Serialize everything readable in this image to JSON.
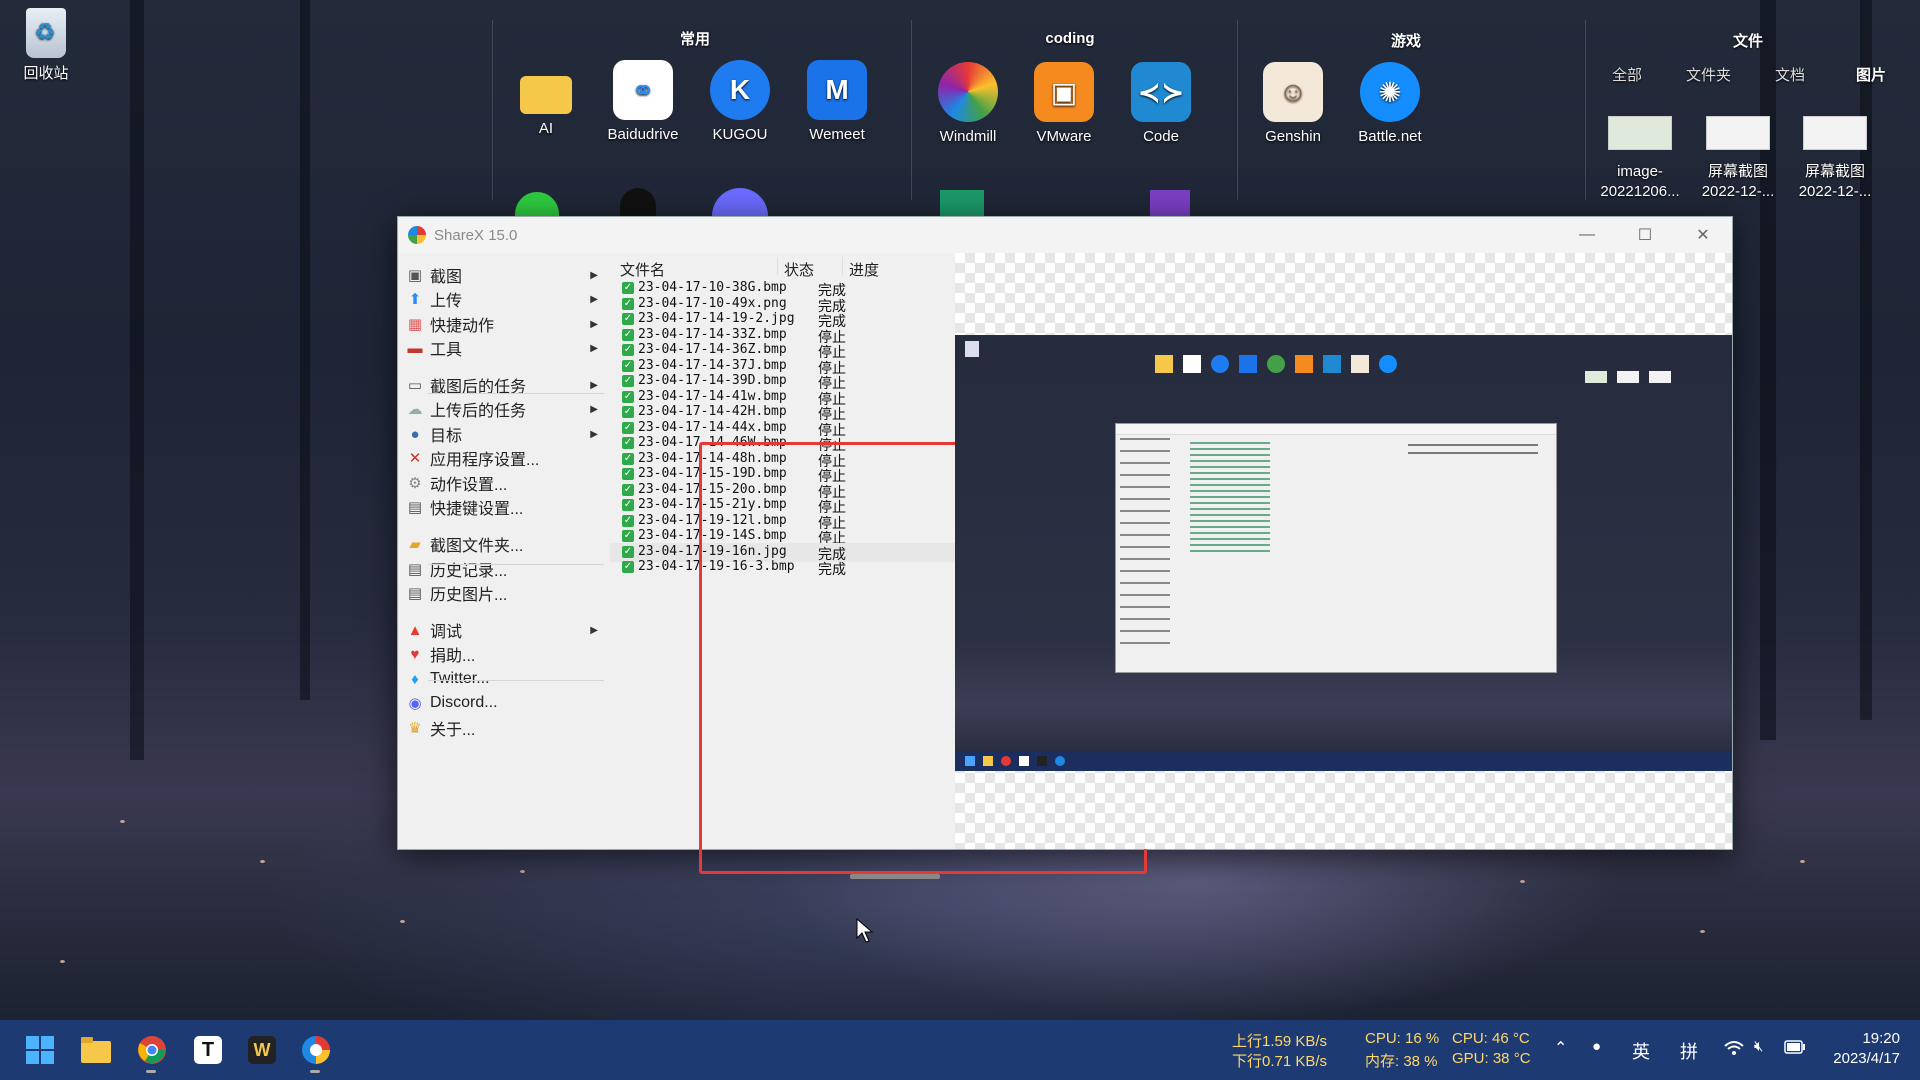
{
  "desktop": {
    "recycle_bin": "回收站",
    "groups": [
      {
        "title": "常用",
        "icons": [
          "AI",
          "Baidudrive",
          "KUGOU",
          "Wemeet"
        ]
      },
      {
        "title": "coding",
        "icons": [
          "Windmill",
          "VMware",
          "Code"
        ]
      },
      {
        "title": "游戏",
        "icons": [
          "Genshin",
          "Battle.net"
        ]
      },
      {
        "title": "文件",
        "tabs": [
          "全部",
          "文件夹",
          "文档",
          "图片"
        ],
        "files": [
          {
            "l1": "image-",
            "l2": "20221206..."
          },
          {
            "l1": "屏幕截图",
            "l2": "2022-12-..."
          },
          {
            "l1": "屏幕截图",
            "l2": "2022-12-..."
          }
        ]
      }
    ]
  },
  "window": {
    "title": "ShareX 15.0",
    "menu": [
      {
        "label": "截图",
        "icon": "camera-icon",
        "submenu": true
      },
      {
        "label": "上传",
        "icon": "upload-arrow-icon",
        "submenu": true
      },
      {
        "label": "快捷动作",
        "icon": "grid-icon",
        "submenu": true
      },
      {
        "label": "工具",
        "icon": "toolbox-icon",
        "submenu": true
      },
      {
        "label": "截图后的任务",
        "icon": "monitor-icon",
        "submenu": true
      },
      {
        "label": "上传后的任务",
        "icon": "cloud-icon",
        "submenu": true
      },
      {
        "label": "目标",
        "icon": "user-icon",
        "submenu": true
      },
      {
        "label": "应用程序设置...",
        "icon": "wrench-icon",
        "submenu": false
      },
      {
        "label": "动作设置...",
        "icon": "gear-icon",
        "submenu": false
      },
      {
        "label": "快捷键设置...",
        "icon": "keyboard-icon",
        "submenu": false
      },
      {
        "label": "截图文件夹...",
        "icon": "folder-icon",
        "submenu": false
      },
      {
        "label": "历史记录...",
        "icon": "history-icon",
        "submenu": false
      },
      {
        "label": "历史图片...",
        "icon": "image-history-icon",
        "submenu": false
      },
      {
        "label": "调试",
        "icon": "debug-icon",
        "submenu": true
      },
      {
        "label": "捐助...",
        "icon": "heart-icon",
        "submenu": false
      },
      {
        "label": "Twitter...",
        "icon": "twitter-icon",
        "submenu": false
      },
      {
        "label": "Discord...",
        "icon": "discord-icon",
        "submenu": false
      },
      {
        "label": "关于...",
        "icon": "crown-icon",
        "submenu": false
      }
    ],
    "columns": {
      "filename": "文件名",
      "status": "状态",
      "progress": "进度"
    },
    "files": [
      {
        "name": "23-04-17-10-38G.bmp",
        "status": "完成"
      },
      {
        "name": "23-04-17-10-49x.png",
        "status": "完成"
      },
      {
        "name": "23-04-17-14-19-2.jpg",
        "status": "完成"
      },
      {
        "name": "23-04-17-14-33Z.bmp",
        "status": "停止"
      },
      {
        "name": "23-04-17-14-36Z.bmp",
        "status": "停止"
      },
      {
        "name": "23-04-17-14-37J.bmp",
        "status": "停止"
      },
      {
        "name": "23-04-17-14-39D.bmp",
        "status": "停止"
      },
      {
        "name": "23-04-17-14-41w.bmp",
        "status": "停止"
      },
      {
        "name": "23-04-17-14-42H.bmp",
        "status": "停止"
      },
      {
        "name": "23-04-17-14-44x.bmp",
        "status": "停止"
      },
      {
        "name": "23-04-17-14-46W.bmp",
        "status": "停止"
      },
      {
        "name": "23-04-17-14-48h.bmp",
        "status": "停止"
      },
      {
        "name": "23-04-17-15-19D.bmp",
        "status": "停止"
      },
      {
        "name": "23-04-17-15-20o.bmp",
        "status": "停止"
      },
      {
        "name": "23-04-17-15-21y.bmp",
        "status": "停止"
      },
      {
        "name": "23-04-17-19-12l.bmp",
        "status": "停止"
      },
      {
        "name": "23-04-17-19-14S.bmp",
        "status": "停止"
      },
      {
        "name": "23-04-17-19-16n.jpg",
        "status": "完成"
      },
      {
        "name": "23-04-17-19-16-3.bmp",
        "status": "完成"
      }
    ],
    "selected_file_index": 17
  },
  "taskbar": {
    "apps": [
      "start-icon",
      "file-explorer-icon",
      "chrome-icon",
      "typora-icon",
      "wps-icon",
      "browser-icon"
    ],
    "net_up": "上行1.59 KB/s",
    "net_down": "下行0.71 KB/s",
    "cpu_usage": "CPU: 16 %",
    "mem_usage": "内存: 38 %",
    "cpu_temp": "CPU: 46 °C",
    "gpu_temp": "GPU: 38 °C",
    "lang": "英",
    "ime": "拼",
    "time": "19:20",
    "date": "2023/4/17"
  },
  "colors": {
    "taskbar": "#1d3a72",
    "highlight_box": "#e53935",
    "done_check": "#2eaa4a"
  }
}
